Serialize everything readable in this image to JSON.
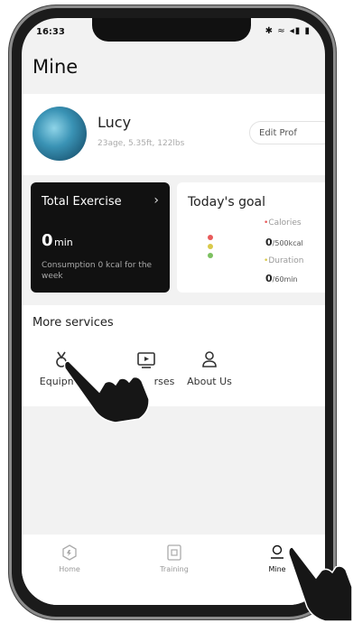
{
  "status": {
    "time": "16:33",
    "icons": "✱ ≈ ◂▮ ▮"
  },
  "page": {
    "title": "Mine"
  },
  "profile": {
    "name": "Lucy",
    "stats": "23age, 5.35ft, 122lbs",
    "edit_label": "Edit Prof"
  },
  "exercise": {
    "title": "Total Exercise",
    "value": "0",
    "unit": "min",
    "note": "Consumption 0 kcal for the week"
  },
  "goal": {
    "title": "Today's goal",
    "calories_label": "Calories",
    "calories_value": "0",
    "calories_unit": "/500kcal",
    "duration_label": "Duration",
    "duration_value": "0",
    "duration_unit": "/60min"
  },
  "services": {
    "title": "More services",
    "items": [
      {
        "label": "Equipme",
        "icon": "equipment-icon"
      },
      {
        "label": "rses",
        "icon": "courses-icon"
      },
      {
        "label": "About Us",
        "icon": "about-us-icon"
      }
    ]
  },
  "nav": {
    "items": [
      {
        "label": "Home",
        "icon": "home-icon"
      },
      {
        "label": "Training",
        "icon": "training-icon"
      },
      {
        "label": "Mine",
        "icon": "mine-icon"
      }
    ]
  },
  "colors": {
    "accent_red": "#e85a5a",
    "accent_yellow": "#d9c94a",
    "dot_green": "#7cc060",
    "card_dark": "#111111"
  }
}
